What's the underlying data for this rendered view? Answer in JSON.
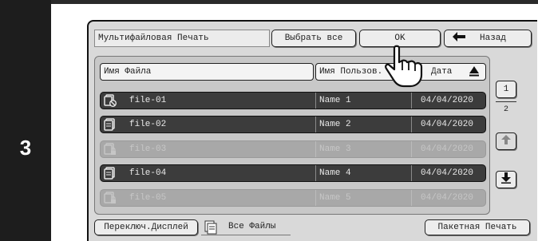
{
  "step": {
    "number": "3"
  },
  "header": {
    "title": "Мультифайловая Печать",
    "select_all": "Выбрать все",
    "ok": "OK",
    "back": "Назад"
  },
  "columns": {
    "file_name": "Имя Файла",
    "user_name": "Имя Пользов.",
    "date": "Дата"
  },
  "rows": [
    {
      "file": "file-01",
      "user": "Name 1",
      "date": "04/04/2020",
      "state": "active",
      "icon": "file-stack-no-print-icon"
    },
    {
      "file": "file-02",
      "user": "Name 2",
      "date": "04/04/2020",
      "state": "active",
      "icon": "file-stack-icon"
    },
    {
      "file": "file-03",
      "user": "Name 3",
      "date": "04/04/2020",
      "state": "disabled",
      "icon": "file-stack-locked-icon"
    },
    {
      "file": "file-04",
      "user": "Name 4",
      "date": "04/04/2020",
      "state": "active",
      "icon": "file-stack-icon"
    },
    {
      "file": "file-05",
      "user": "Name 5",
      "date": "04/04/2020",
      "state": "disabled",
      "icon": "file-stack-locked-icon"
    }
  ],
  "pagination": {
    "current": "1",
    "total": "2"
  },
  "footer": {
    "switch_display": "Переключ.Дисплей",
    "all_files": "Все Файлы",
    "batch_print": "Пакетная Печать"
  },
  "colors": {
    "row_active": "#3c3c3c",
    "row_disabled": "#a8a8a8",
    "panel": "#d9d9d9"
  }
}
